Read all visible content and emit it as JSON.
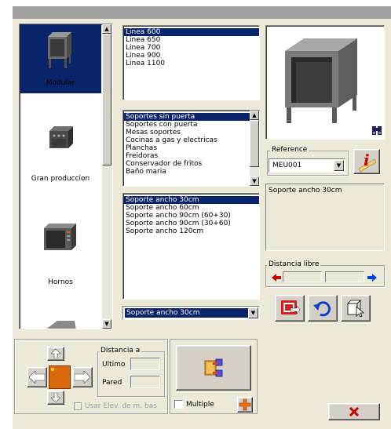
{
  "categories": [
    {
      "label": "Modular",
      "selected": true
    },
    {
      "label": "Gran produccion",
      "selected": false
    },
    {
      "label": "Hornos",
      "selected": false
    }
  ],
  "lineas": [
    "Linea 600",
    "Linea 650",
    "Linea 700",
    "Linea 900",
    "Linea 1100"
  ],
  "tipos": [
    "Soportes sin puerta",
    "Soportes con puerta",
    "Mesas soportes",
    "Cocinas a gas y electricas",
    "Planchas",
    "Freidoras",
    "Conservador de fritos",
    "Baño maria"
  ],
  "modelos": [
    "Soporte ancho 30cm",
    "Soporte ancho 60cm",
    "Soporte ancho 90cm (60+30)",
    "Soporte ancho 90cm (30+60)",
    "Soporte ancho 120cm"
  ],
  "modelo_combo": "Soporte ancho 30cm",
  "reference": {
    "label": "Reference",
    "value": "MEU001"
  },
  "description": "Soporte ancho 30cm",
  "distancia_libre": {
    "label": "Distancia libre"
  },
  "distancia_a": {
    "label": "Distancia a",
    "ultimo": "Ultimo",
    "pared": "Pared"
  },
  "usar_elev": "Usar Elev. de m. bas",
  "multiple": "Multiple",
  "colors": {
    "selection": "#0a246a",
    "panel": "#ece9d8",
    "orange": "#d96a0c"
  }
}
